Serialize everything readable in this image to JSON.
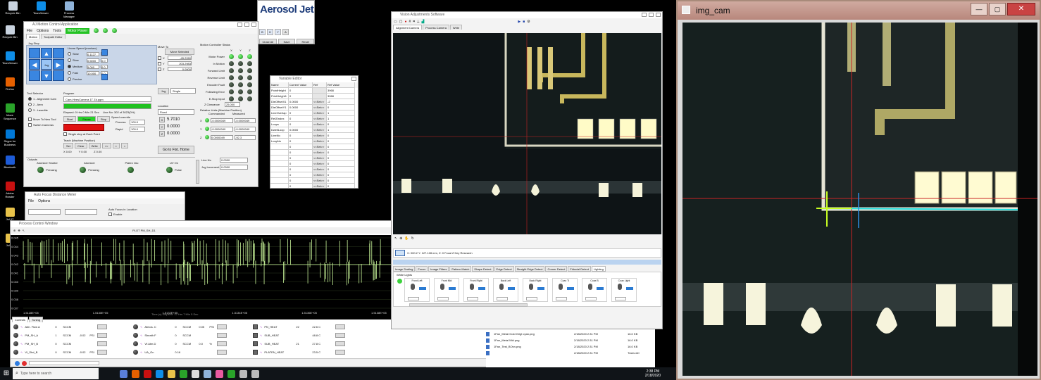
{
  "desktop": {
    "icons": [
      {
        "label": "Recycle Bin",
        "color": "#c9d3df"
      },
      {
        "label": "TeamViewer",
        "color": "#0e8ee9"
      },
      {
        "label": "Firefox",
        "color": "#e66000"
      },
      {
        "label": "Move Sequence",
        "color": "#2aa32a"
      },
      {
        "label": "Skype for Business",
        "color": "#0078d7"
      },
      {
        "label": "Bluetooth",
        "color": "#1d5bd7"
      },
      {
        "label": "Adobe Reader",
        "color": "#c81010"
      },
      {
        "label": "Jul 07",
        "color": "#e8c24a"
      },
      {
        "label": "Jul 09",
        "color": "#e8c24a"
      }
    ],
    "top_icons": [
      {
        "label": "Recycle Bin",
        "color": "#c9d3df"
      },
      {
        "label": "TeamViewer",
        "color": "#0e8ee9"
      },
      {
        "label": "Process Manager",
        "color": "#8fb3d9"
      }
    ]
  },
  "aerosol": {
    "logo": "Aerosol Jet",
    "buttons": [
      "Close All",
      "Save",
      "Reset"
    ]
  },
  "motion": {
    "title": "AJ Motion Control Application",
    "menu": [
      "File",
      "Options",
      "Tools",
      "Motor Power"
    ],
    "tabs": [
      "Motion",
      "Toolpath Editor"
    ],
    "jog_label": "Jog Step",
    "speed_label": "Linear Speed (mm/sec)",
    "speeds": [
      {
        "name": "Slow",
        "v1": "0.1127",
        "v2": "0.0"
      },
      {
        "name": "Slow",
        "v1": "0.5000",
        "v2": "0.0"
      },
      {
        "name": "Medium",
        "v1": "5.000",
        "v2": "0.0"
      },
      {
        "name": "Fast",
        "v1": "10.000",
        "v2": "0.0"
      },
      {
        "name": "Precise",
        "v1": "",
        "v2": ""
      }
    ],
    "move_to": "Move To",
    "move_selected": "Move Selected",
    "axes": [
      {
        "name": "X",
        "v": "-45.2260"
      },
      {
        "name": "Y",
        "v": "203.2983"
      },
      {
        "name": "Z",
        "v": "0.0000"
      }
    ],
    "jog_btn": "Jog",
    "jog_sel": "Single",
    "tool_selector": "Tool Selector",
    "tools": [
      "1 - Alignment Cam",
      "2 - Aero",
      "3 - Laserlite"
    ],
    "move_tool": "Move To New Tool",
    "switch_cameras": "Switch Cameras",
    "program": "Program",
    "program_file": "Cam-HiresCamera 1T Zd.pgm",
    "progress_pct": 1,
    "elapsed": "Elapsed: 0 Hrs 0 Min 21 Sec",
    "line": "Line No: 302 of 3023(0%)",
    "start": "Start",
    "pause": "Pause",
    "stop": "Stop",
    "speed_override": "Speed override",
    "process": "Process",
    "rapid": "Rapid",
    "process_v": "100.0",
    "rapid_v": "100.0",
    "single_step": "Single step at Each Point",
    "teach": "Teach (Machine Position)",
    "teach_btns": [
      "Set",
      "Clear",
      "Write",
      "<<",
      "<",
      ">"
    ],
    "teach_vals": [
      "X 0.00",
      "Y 0.00",
      "Z 0.00"
    ],
    "location": "Location",
    "location_sel": "Fixed",
    "loc_vals": [
      {
        "k": "X",
        "v": "5.7010"
      },
      {
        "k": "Y",
        "v": "0.0000"
      },
      {
        "k": "Z",
        "v": "0.0000"
      }
    ],
    "goto_home": "Go to Fixt. Home",
    "motion_status": "Motion Controller Status",
    "status_cols": [
      "X",
      "Y",
      "Z"
    ],
    "status_rows": [
      "Motor Power",
      "In Motion",
      "Forward Limit",
      "Reverse Limit",
      "Encoder Fault",
      "Following Error",
      "E-Stop Input"
    ],
    "z_clearance": "Z Clearance",
    "z_clear_v": "25.000",
    "rel_offsets": "Relative Units (Machine Position)",
    "commanded": "Commanded",
    "measured": "Measured",
    "pos": [
      {
        "k": "X",
        "c": "-0.0000049",
        "m": "-0.0000049"
      },
      {
        "k": "Y",
        "c": "-0.0000049",
        "m": "-0.0000049"
      },
      {
        "k": "Z",
        "c": "0.0000049",
        "m": "-92.3"
      }
    ],
    "outputs": "Outputs",
    "out_cols": [
      "Atomizer Shutter",
      "Atomizer",
      "Platen Vac",
      "UV On"
    ],
    "out_vals": [
      "Pressing",
      "Pressing",
      "",
      "Pulse"
    ],
    "line_no": "Line No",
    "line_no_v": "0.0000",
    "jog_inc": "Jog Increment",
    "jog_inc_v": "0.0000"
  },
  "vartable": {
    "title": "Variable Editor",
    "headers": [
      "Name",
      "Current Value",
      "Ref",
      "Ref Value"
    ],
    "rows": [
      {
        "n": "PointHeight",
        "v": "0",
        "r": "",
        "rv": "3968"
      },
      {
        "n": "PrintHeight1",
        "v": "0",
        "r": "",
        "rv": "3968"
      },
      {
        "n": "DieOffsetX1",
        "v": "0.0000",
        "r": "<<Set>>",
        "rv": "-2"
      },
      {
        "n": "DieOffsetY1",
        "v": "0.0000",
        "r": "<<Set>>",
        "rv": "0"
      },
      {
        "n": "LineOverlap",
        "v": "0",
        "r": "<<Set>>",
        "rv": "1"
      },
      {
        "n": "RefZIndex",
        "v": "0",
        "r": "<<Set>>",
        "rv": "1"
      },
      {
        "n": "Loops",
        "v": "0",
        "r": "<<Set>>",
        "rv": "0"
      },
      {
        "n": "DwellLoop",
        "v": "0.0000",
        "r": "<<Set>>",
        "rv": "1"
      },
      {
        "n": "LineNo",
        "v": "0",
        "r": "<<Set>>",
        "rv": "0"
      },
      {
        "n": "LoopNo",
        "v": "0",
        "r": "<<Set>>",
        "rv": "0"
      },
      {
        "n": "",
        "v": "0",
        "r": "<<Set>>",
        "rv": "0"
      },
      {
        "n": "",
        "v": "0",
        "r": "<<Set>>",
        "rv": "0"
      },
      {
        "n": "",
        "v": "0",
        "r": "<<Set>>",
        "rv": "0"
      },
      {
        "n": "",
        "v": "0",
        "r": "<<Set>>",
        "rv": "0"
      },
      {
        "n": "",
        "v": "0",
        "r": "<<Set>>",
        "rv": "0"
      },
      {
        "n": "",
        "v": "0",
        "r": "<<Set>>",
        "rv": "0"
      },
      {
        "n": "",
        "v": "0",
        "r": "<<Set>>",
        "rv": "0"
      },
      {
        "n": "",
        "v": "0",
        "r": "<<Set>>",
        "rv": "0"
      }
    ]
  },
  "small": {
    "title": "Auto Focus Distance Meter",
    "menu": [
      "File",
      "Options"
    ],
    "auto_label": "Auto Focus in Location",
    "enable": "Enable"
  },
  "process": {
    "title": "Process Control Window",
    "toolbar_text": "PLOT PM_SH_D1",
    "yticks": [
      "0.045",
      "0.044",
      "0.043",
      "0.042",
      "0.041",
      "0.040",
      "0.039",
      "0.038",
      "0.037"
    ],
    "xticks": [
      "1.5128E+05",
      "1.5130E+05",
      "1.5132E+05",
      "1.5134E+05",
      "1.5136E+05",
      "1.5138E+05"
    ],
    "xlabel": "Time (s) Elapsed: 12 Hrs 7 Min 5 Sec",
    "tabs": [
      "Controls",
      "Tuning"
    ],
    "channels": [
      {
        "name": "Atm. Flow A",
        "v": "0",
        "u": "SCCM",
        "p": "",
        "pu": ""
      },
      {
        "name": "PM_SH_A",
        "v": "1",
        "u": "SCCM",
        "p": "-0.02",
        "pu": "PSI"
      },
      {
        "name": "PM_SH_B",
        "v": "0",
        "u": "SCCM",
        "p": "",
        "pu": ""
      },
      {
        "name": "VI_Shd_B",
        "v": "0",
        "u": "SCCM",
        "p": "-0.02",
        "pu": "PSI"
      }
    ],
    "channels2": [
      {
        "name": "Atmos. C",
        "v": "0",
        "u": "SCCM",
        "p": "0.05",
        "pu": "PSI"
      },
      {
        "name": "Sheath F",
        "v": "0",
        "u": "SCCM",
        "p": "",
        "pu": ""
      },
      {
        "name": "Vf.Atm.D",
        "v": "0",
        "u": "SCCM",
        "p": "0.0",
        "pu": "%"
      },
      {
        "name": "UA_On",
        "v": "0.16",
        "u": "",
        "p": "",
        "pu": ""
      }
    ],
    "channels3": [
      {
        "name": "PN_HEAT",
        "v": "22",
        "u": "22.6 C"
      },
      {
        "name": "SUB_HEAT",
        "v": "",
        "u": "48.8 C"
      },
      {
        "name": "SUB_HEAT",
        "v": "21",
        "u": "27.8 C"
      },
      {
        "name": "PLATEN_HEAT",
        "v": "",
        "u": "23.5 C"
      }
    ]
  },
  "vision": {
    "title": "Vision Adjustments Software",
    "tabs": [
      "Alignment Camera",
      "Process Camera",
      "Write"
    ],
    "status": "X: 000.2 Y: 127.128 mm, Z: 0 Focal Z Key Research",
    "sub_tabs": [
      "Image Scaling",
      "Focus",
      "Image Filters",
      "Pattern Match",
      "Shape Detect",
      "Edge Detect",
      "Straight Edge Detect",
      "Corner Detect",
      "Fiducial Detect",
      "Lighting"
    ],
    "light_title": "White Lights",
    "lights": [
      "Front Left",
      "Front Mid",
      "Front Right",
      "Back Left",
      "Back Right",
      "Coax Ti",
      "Coax B",
      "Coax Light"
    ]
  },
  "files": {
    "rows": [
      {
        "name": "1Fan_Metal Gold Grigt cyan.png",
        "date": "2/18/2020 2:31 PM",
        "size": "16.0 KB"
      },
      {
        "name": "1Fan_Metal Mid.png",
        "date": "2/18/2020 2:31 PM",
        "size": "16.0 KB"
      },
      {
        "name": "1Fan_Test_BOvn.png",
        "date": "2/18/2020 2:31 PM",
        "size": "16.0 KB"
      },
      {
        "name": "",
        "date": "2/18/2020 2:31 PM",
        "size": "Trans del"
      }
    ]
  },
  "imgcam": {
    "title": "img_cam"
  },
  "taskbar": {
    "search": "Type here to search",
    "time": "2:38 PM",
    "date": "2/18/2020"
  }
}
